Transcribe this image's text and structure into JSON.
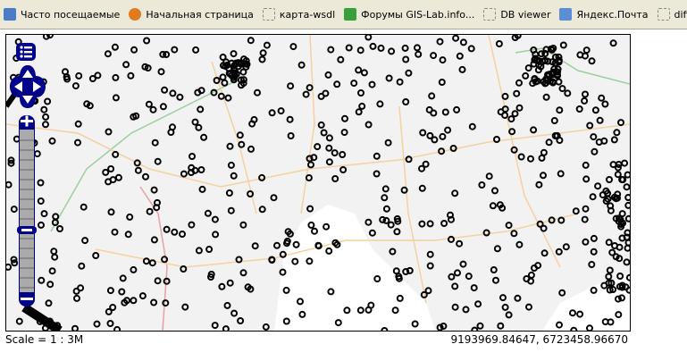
{
  "bookmarks": [
    {
      "label": "Часто посещаемые",
      "icon": "frequent-icon",
      "color": "#4a7cc9"
    },
    {
      "label": "Начальная страница",
      "icon": "firefox-icon",
      "color": "#e07b20"
    },
    {
      "label": "карта-wsdl",
      "icon": "page-icon",
      "color": ""
    },
    {
      "label": "Форумы GIS-Lab.info...",
      "icon": "gislab-icon",
      "color": "#3aa03a"
    },
    {
      "label": "DB viewer",
      "icon": "page-icon",
      "color": ""
    },
    {
      "label": "Яндекс.Почта",
      "icon": "mail-icon",
      "color": "#5b8ed6"
    },
    {
      "label": "difference betwe",
      "icon": "page-icon",
      "color": ""
    }
  ],
  "map": {
    "controls_color": "#00008b",
    "background": "#f2f2f2"
  },
  "footer": {
    "scale": "Scale = 1 : 3M",
    "coords": "9193969.84647, 6723458.96670"
  }
}
